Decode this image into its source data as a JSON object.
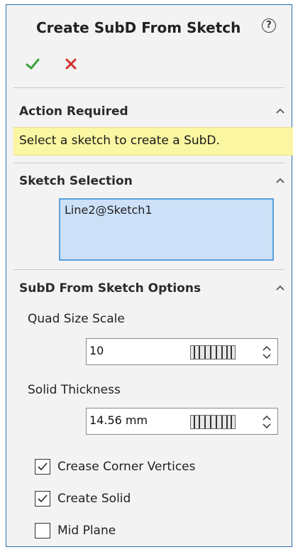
{
  "header": {
    "title": "Create SubD From Sketch",
    "help_icon": "help-icon"
  },
  "actions": {
    "ok_icon": "checkmark-icon",
    "cancel_icon": "close-icon",
    "ok_color": "#3aa23a",
    "cancel_color": "#d0302a"
  },
  "action_required": {
    "title": "Action Required",
    "message": "Select a sketch to create a SubD.",
    "highlight_color": "#fbf6a2"
  },
  "sketch_selection": {
    "title": "Sketch Selection",
    "items": [
      "Line2@Sketch1"
    ]
  },
  "options": {
    "title": "SubD From Sketch Options",
    "quad_size_scale": {
      "label": "Quad Size Scale",
      "value": "10"
    },
    "solid_thickness": {
      "label": "Solid Thickness",
      "value": "14.56 mm"
    },
    "checkboxes": [
      {
        "label": "Crease Corner Vertices",
        "checked": true
      },
      {
        "label": "Create Solid",
        "checked": true
      },
      {
        "label": "Mid Plane",
        "checked": false
      }
    ]
  }
}
